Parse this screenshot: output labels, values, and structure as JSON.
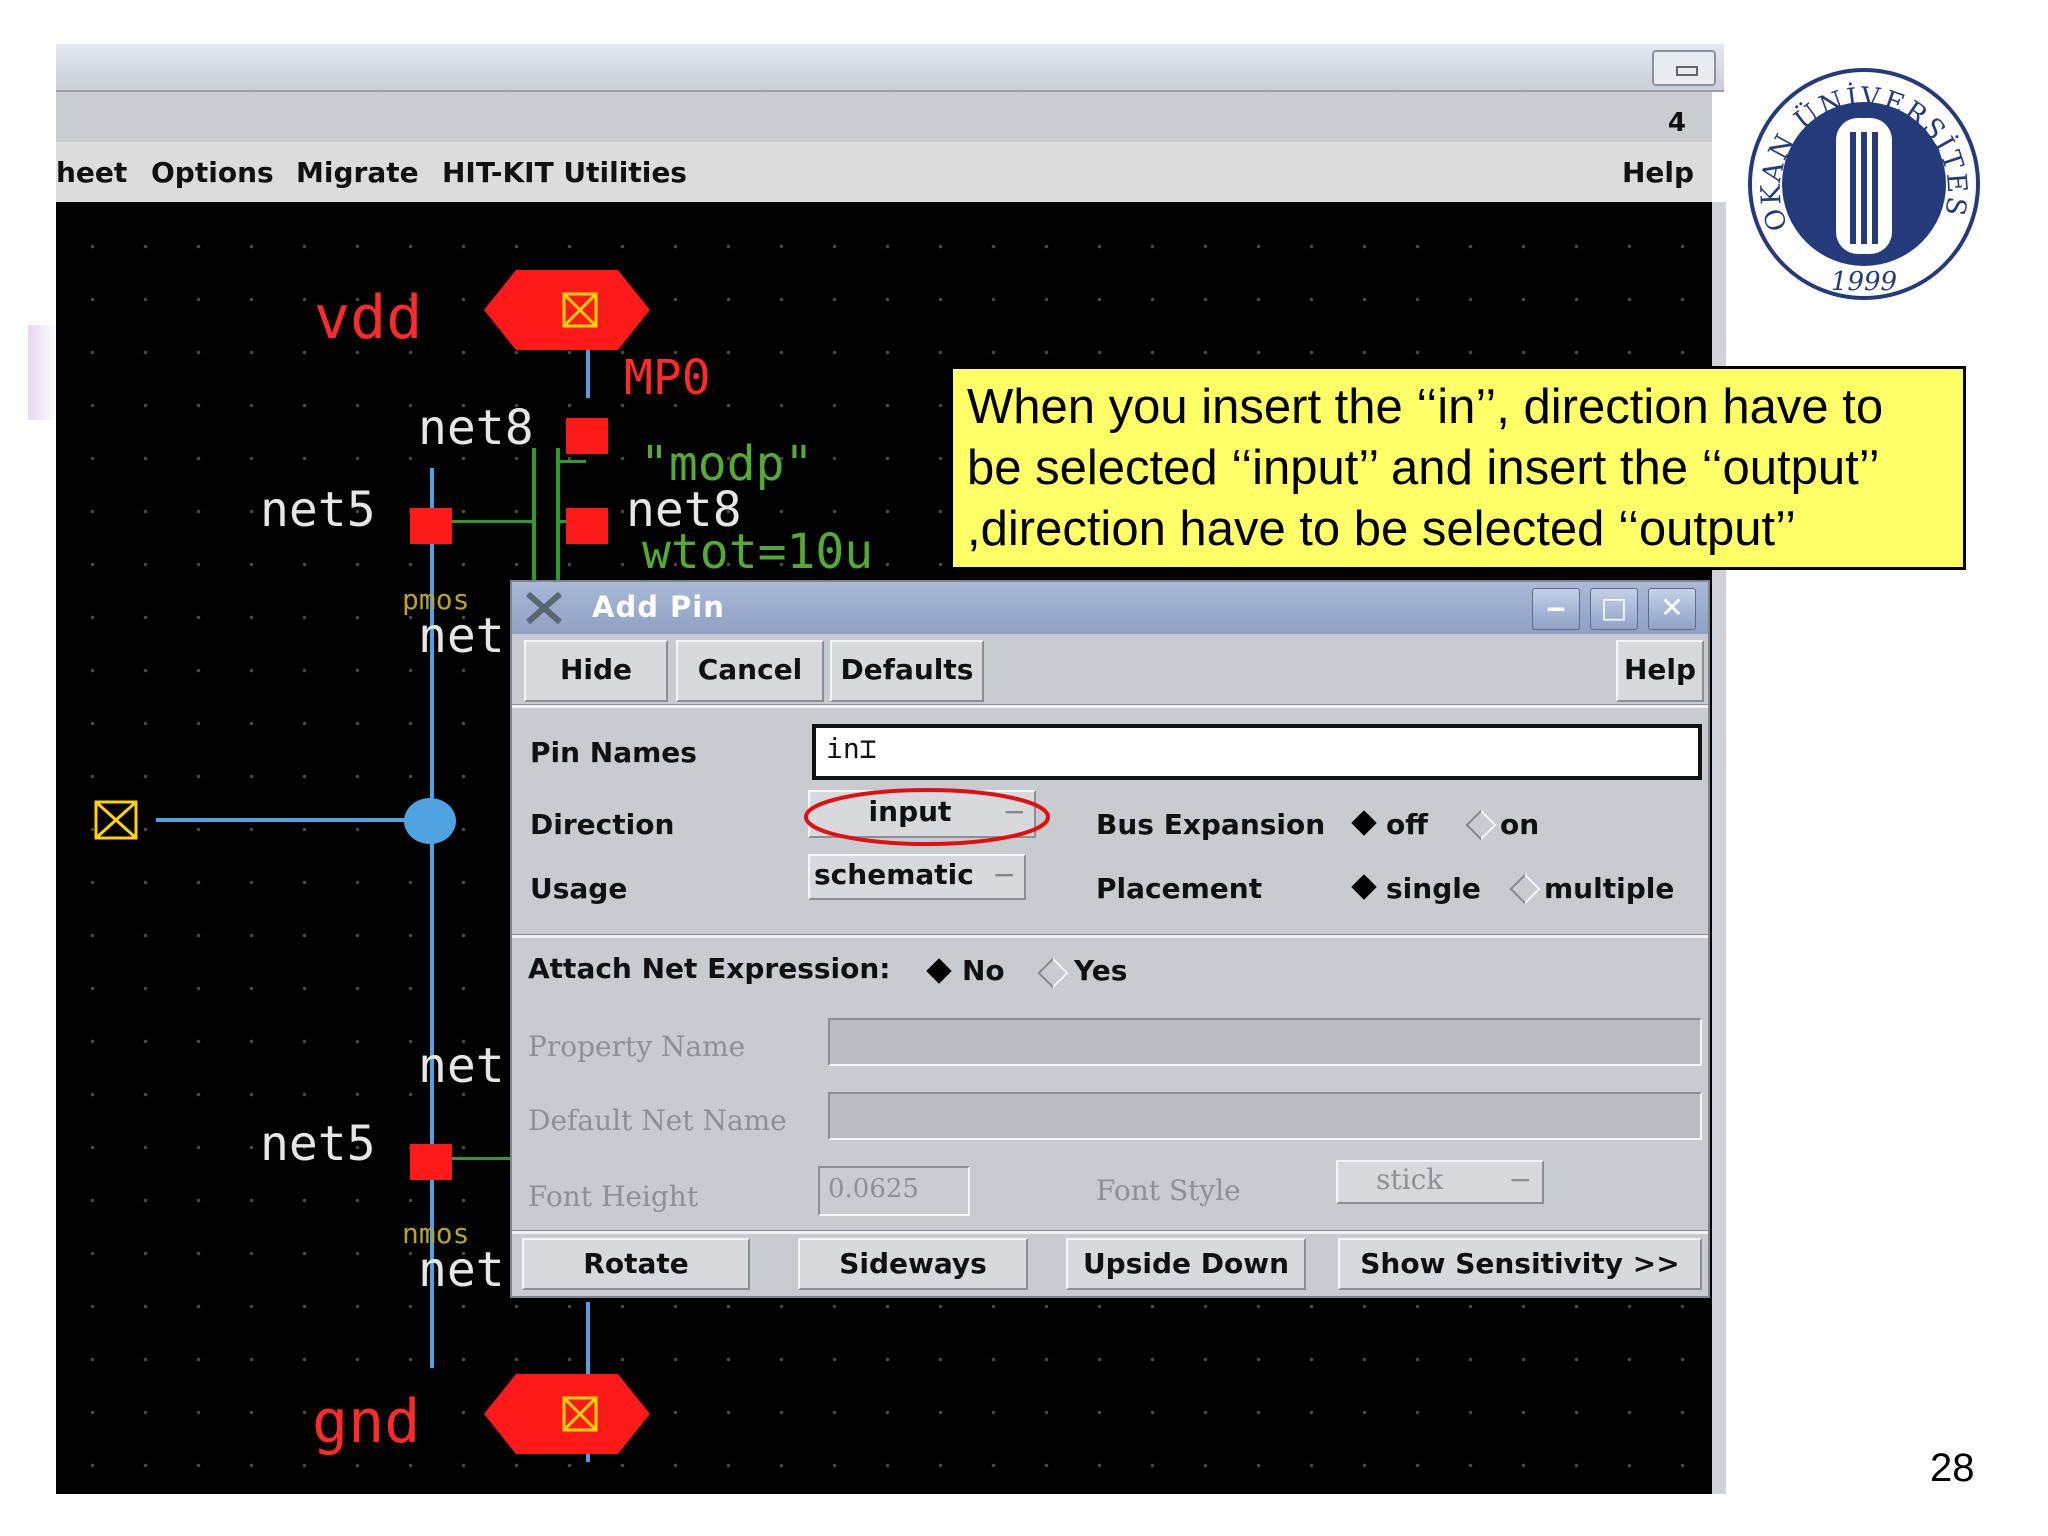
{
  "window": {
    "number_badge": "4"
  },
  "menubar": {
    "items": [
      "heet",
      "Options",
      "Migrate",
      "HIT-KIT Utilities"
    ],
    "help": "Help"
  },
  "schematic": {
    "labels": {
      "vdd": "vdd",
      "gnd": "gnd",
      "mp0": "MP0",
      "net8_top": "net8",
      "net8_right": "net8",
      "net5_top": "net5",
      "net5_bottom": "net5",
      "modp": "\"modp\"",
      "wtot": "wtot=10u",
      "pmos": "pmos",
      "nmos": "nmos",
      "net_cut_1": "net",
      "net_cut_2": "net",
      "net_cut_3": "net"
    },
    "colors": {
      "pin": "#ff1a1a",
      "wire": "#4ea3e0",
      "net_text": "#e6e6e6",
      "supply_text": "#ff2a2a",
      "device_text": "#55aa33"
    }
  },
  "callout": {
    "lines": [
      "When you insert the ‘‘in’’, direction have to",
      "be selected ‘‘input’’ and insert the ‘‘output’’",
      ",direction have to be selected ‘‘output’’"
    ]
  },
  "logo": {
    "arc_text": "OKAN ÜNİVERSİTESİ",
    "year": "1999"
  },
  "page_number": "28",
  "dialog": {
    "title": "Add Pin",
    "buttons": {
      "hide": "Hide",
      "cancel": "Cancel",
      "defaults": "Defaults",
      "help": "Help"
    },
    "pin_names": {
      "label": "Pin Names",
      "value": "in"
    },
    "direction": {
      "label": "Direction",
      "value": "input"
    },
    "usage": {
      "label": "Usage",
      "value": "schematic"
    },
    "bus_expansion": {
      "label": "Bus Expansion",
      "options": [
        "off",
        "on"
      ],
      "selected": "off"
    },
    "placement": {
      "label": "Placement",
      "options": [
        "single",
        "multiple"
      ],
      "selected": "single"
    },
    "attach_net": {
      "label": "Attach Net Expression:",
      "options": [
        "No",
        "Yes"
      ],
      "selected": "No"
    },
    "property_name": {
      "label": "Property Name",
      "value": ""
    },
    "default_net_name": {
      "label": "Default Net Name",
      "value": ""
    },
    "font_height": {
      "label": "Font Height",
      "value": "0.0625"
    },
    "font_style": {
      "label": "Font Style",
      "value": "stick"
    },
    "bottom_buttons": {
      "rotate": "Rotate",
      "sideways": "Sideways",
      "upside_down": "Upside Down",
      "show_sensitivity": "Show Sensitivity >>"
    },
    "highlight_color": "#e01010"
  }
}
